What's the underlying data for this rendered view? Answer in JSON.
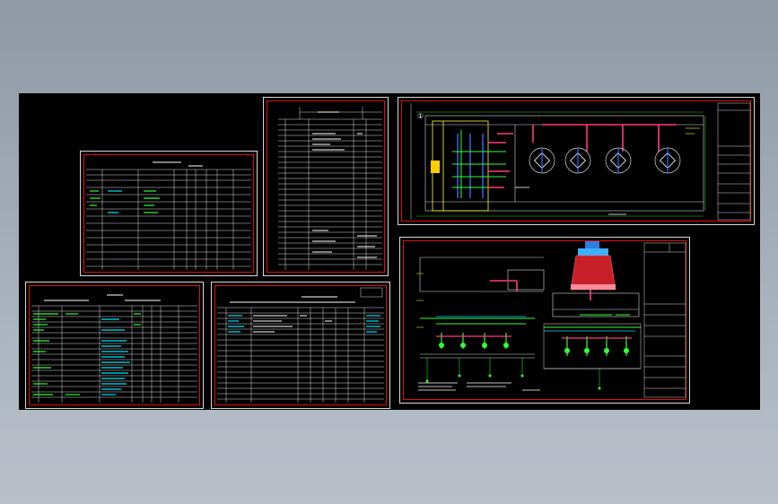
{
  "viewport": {
    "background": "#000000",
    "frame_color": "#e01010",
    "line_color": "#d9d9d9",
    "accent_colors": [
      "#00e5ff",
      "#33ff33",
      "#ff3b7f",
      "#ffff33",
      "#3b6bff"
    ]
  },
  "sheets": [
    {
      "name": "sheet-table-mid-left",
      "kind": "table"
    },
    {
      "name": "sheet-table-tall",
      "kind": "table"
    },
    {
      "name": "sheet-table-bottom-left",
      "kind": "table"
    },
    {
      "name": "sheet-table-bottom-mid",
      "kind": "table"
    },
    {
      "name": "sheet-plan-drawing",
      "kind": "drawing"
    },
    {
      "name": "sheet-system-diagram",
      "kind": "drawing"
    }
  ],
  "plan_drawing": {
    "marker": "①"
  }
}
